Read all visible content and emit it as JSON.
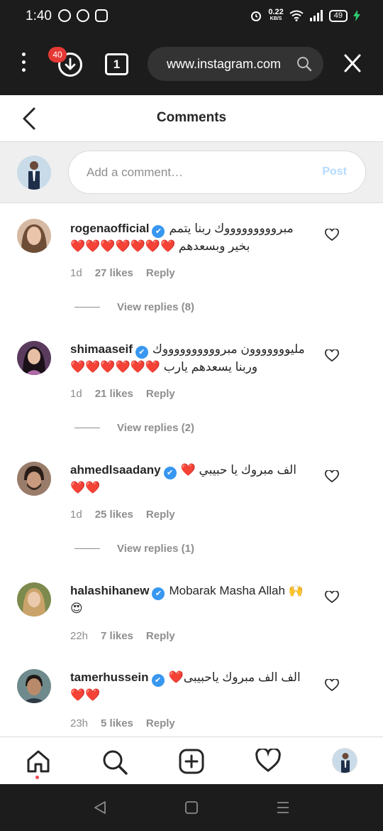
{
  "status_bar": {
    "time": "1:40",
    "net_speed": "0.22",
    "net_unit": "KB/S",
    "battery": "49"
  },
  "browser": {
    "download_badge": "40",
    "tab_count": "1",
    "url": "www.instagram.com"
  },
  "header": {
    "title": "Comments"
  },
  "composer": {
    "placeholder": "Add a comment…",
    "post_label": "Post"
  },
  "comments": [
    {
      "user": "rogenaofficial",
      "text": "مبروووووووووك ربنا يتمم بخير وبسعدهم ❤️❤️❤️❤️❤️❤️❤️",
      "time": "1d",
      "likes": "27 likes",
      "reply": "Reply",
      "view_replies": "View replies (8)"
    },
    {
      "user": "shimaaseif",
      "text": "مليووووووون مبرووووووووووك وربنا يسعدهم يارب ❤️❤️❤️❤️❤️❤️",
      "time": "1d",
      "likes": "21 likes",
      "reply": "Reply",
      "view_replies": "View replies (2)"
    },
    {
      "user": "ahmedlsaadany",
      "text": "الف مبروك يا حبيبي ❤️❤️❤️",
      "time": "1d",
      "likes": "25 likes",
      "reply": "Reply",
      "view_replies": "View replies (1)"
    },
    {
      "user": "halashihanew",
      "text": "Mobarak Masha Allah 🙌😍",
      "time": "22h",
      "likes": "7 likes",
      "reply": "Reply"
    },
    {
      "user": "tamerhussein",
      "text": "الف الف مبروك ياحبيبى❤️❤️❤️",
      "time": "23h",
      "likes": "5 likes",
      "reply": "Reply"
    }
  ],
  "colors": {
    "verified": "#3897f0",
    "post_disabled": "#b3dbff",
    "dark_bar": "#1c1c1c",
    "notification_dot": "#ed4956"
  }
}
